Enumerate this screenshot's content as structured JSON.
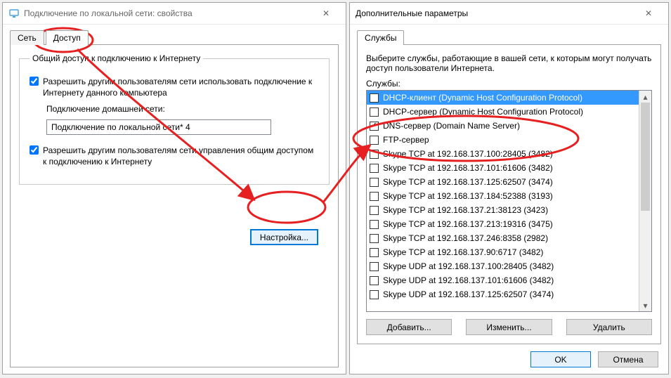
{
  "left": {
    "title": "Подключение по локальной сети: свойства",
    "tabs": {
      "net": "Сеть",
      "access": "Доступ"
    },
    "group_title": "Общий доступ к подключению к Интернету",
    "chk_allow_use": "Разрешить другим пользователям сети использовать подключение к Интернету данного компьютера",
    "home_conn_label": "Подключение домашней сети:",
    "home_conn_value": "Подключение по локальной сети* 4",
    "chk_allow_manage": "Разрешить другим пользователям сети управления общим доступом к подключению к Интернету",
    "btn_settings": "Настройка..."
  },
  "right": {
    "title": "Дополнительные параметры",
    "tab_services": "Службы",
    "instr": "Выберите службы, работающие в вашей сети, к которым могут получать доступ пользователи Интернета.",
    "list_label": "Службы:",
    "items": [
      {
        "c": false,
        "t": "DHCP-клиент (Dynamic Host Configuration Protocol)",
        "sel": true
      },
      {
        "c": false,
        "t": "DHCP-сервер (Dynamic Host Configuration Protocol)"
      },
      {
        "c": true,
        "t": "DNS-сервер (Domain Name Server)"
      },
      {
        "c": false,
        "t": "FTP-сервер"
      },
      {
        "c": false,
        "t": "Skype TCP at 192.168.137.100:28405 (3482)"
      },
      {
        "c": false,
        "t": "Skype TCP at 192.168.137.101:61606 (3482)"
      },
      {
        "c": false,
        "t": "Skype TCP at 192.168.137.125:62507 (3474)"
      },
      {
        "c": false,
        "t": "Skype TCP at 192.168.137.184:52388 (3193)"
      },
      {
        "c": false,
        "t": "Skype TCP at 192.168.137.21:38123 (3423)"
      },
      {
        "c": false,
        "t": "Skype TCP at 192.168.137.213:19316 (3475)"
      },
      {
        "c": false,
        "t": "Skype TCP at 192.168.137.246:8358 (2982)"
      },
      {
        "c": false,
        "t": "Skype TCP at 192.168.137.90:6717 (3482)"
      },
      {
        "c": false,
        "t": "Skype UDP at 192.168.137.100:28405 (3482)"
      },
      {
        "c": false,
        "t": "Skype UDP at 192.168.137.101:61606 (3482)"
      },
      {
        "c": false,
        "t": "Skype UDP at 192.168.137.125:62507 (3474)"
      }
    ],
    "btn_add": "Добавить...",
    "btn_edit": "Изменить...",
    "btn_del": "Удалить",
    "btn_ok": "OK",
    "btn_cancel": "Отмена"
  }
}
